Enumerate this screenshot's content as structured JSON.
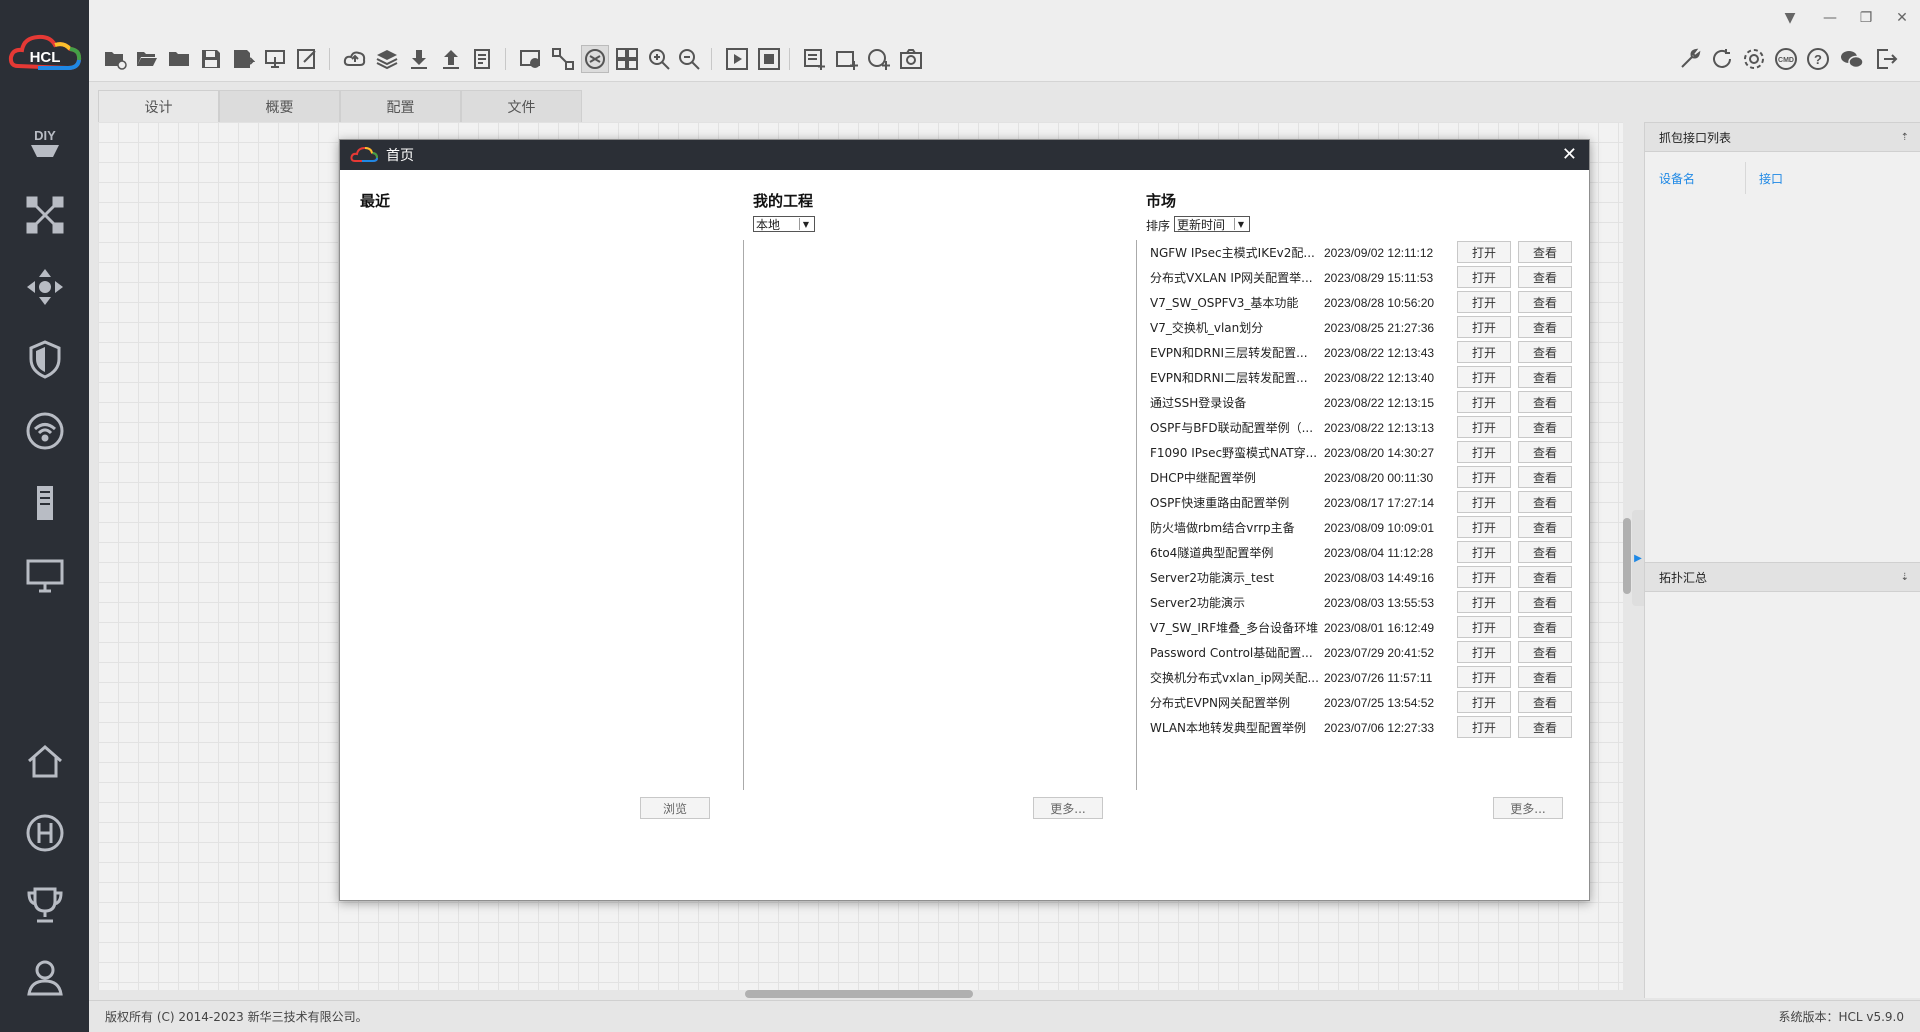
{
  "sidebar": {
    "logo_text": "HCL",
    "items": [
      {
        "icon": "diy-icon",
        "label": "DIY"
      },
      {
        "icon": "network-topology-icon"
      },
      {
        "icon": "move-arrows-icon"
      },
      {
        "icon": "shield-icon"
      },
      {
        "icon": "wifi-icon"
      },
      {
        "icon": "server-icon"
      },
      {
        "icon": "monitor-icon"
      },
      {
        "icon": "home-icon"
      },
      {
        "icon": "h-circle-icon"
      },
      {
        "icon": "trophy-icon"
      },
      {
        "icon": "user-icon"
      }
    ]
  },
  "tabs": [
    {
      "label": "设计"
    },
    {
      "label": "概要"
    },
    {
      "label": "配置"
    },
    {
      "label": "文件"
    }
  ],
  "right_panel": {
    "capture_title": "抓包接口列表",
    "col_device": "设备名",
    "col_interface": "接口",
    "topology_title": "拓扑汇总"
  },
  "dialog": {
    "title": "首页",
    "recent_title": "最近",
    "projects_title": "我的工程",
    "projects_filter": "本地",
    "market_title": "市场",
    "sort_label": "排序",
    "sort_value": "更新时间",
    "browse_label": "浏览",
    "more_projects_label": "更多...",
    "more_market_label": "更多...",
    "open_label": "打开",
    "view_label": "查看",
    "market_items": [
      {
        "name": "NGFW IPsec主模式IKEv2配...",
        "time": "2023/09/02 12:11:12"
      },
      {
        "name": "分布式VXLAN IP网关配置举...",
        "time": "2023/08/29 15:11:53"
      },
      {
        "name": "V7_SW_OSPFV3_基本功能",
        "time": "2023/08/28 10:56:20"
      },
      {
        "name": "V7_交换机_vlan划分",
        "time": "2023/08/25 21:27:36"
      },
      {
        "name": "EVPN和DRNI三层转发配置...",
        "time": "2023/08/22 12:13:43"
      },
      {
        "name": "EVPN和DRNI二层转发配置...",
        "time": "2023/08/22 12:13:40"
      },
      {
        "name": "通过SSH登录设备",
        "time": "2023/08/22 12:13:15"
      },
      {
        "name": "OSPF与BFD联动配置举例（...",
        "time": "2023/08/22 12:13:13"
      },
      {
        "name": "F1090 IPsec野蛮模式NAT穿...",
        "time": "2023/08/20 14:30:27"
      },
      {
        "name": "DHCP中继配置举例",
        "time": "2023/08/20 00:11:30"
      },
      {
        "name": "OSPF快速重路由配置举例",
        "time": "2023/08/17 17:27:14"
      },
      {
        "name": "防火墙做rbm结合vrrp主备",
        "time": "2023/08/09 10:09:01"
      },
      {
        "name": "6to4隧道典型配置举例",
        "time": "2023/08/04 11:12:28"
      },
      {
        "name": "Server2功能演示_test",
        "time": "2023/08/03 14:49:16"
      },
      {
        "name": "Server2功能演示",
        "time": "2023/08/03 13:55:53"
      },
      {
        "name": "V7_SW_IRF堆叠_多台设备环堆",
        "time": "2023/08/01 16:12:49"
      },
      {
        "name": "Password Control基础配置...",
        "time": "2023/07/29 20:41:52"
      },
      {
        "name": "交换机分布式vxlan_ip网关配...",
        "time": "2023/07/26 11:57:11"
      },
      {
        "name": "分布式EVPN网关配置举例",
        "time": "2023/07/25 13:54:52"
      },
      {
        "name": "WLAN本地转发典型配置举例",
        "time": "2023/07/06 12:27:33"
      }
    ]
  },
  "status": {
    "copyright": "版权所有 (C) 2014-2023 新华三技术有限公司。",
    "version": "系统版本：HCL v5.9.0"
  },
  "colors": {
    "sidebar_bg": "#2b2f36",
    "accent_blue": "#1e88e5",
    "logo_red": "#e53935",
    "logo_yellow": "#fbc02d",
    "logo_green": "#43a047",
    "logo_blue": "#1e88e5"
  }
}
